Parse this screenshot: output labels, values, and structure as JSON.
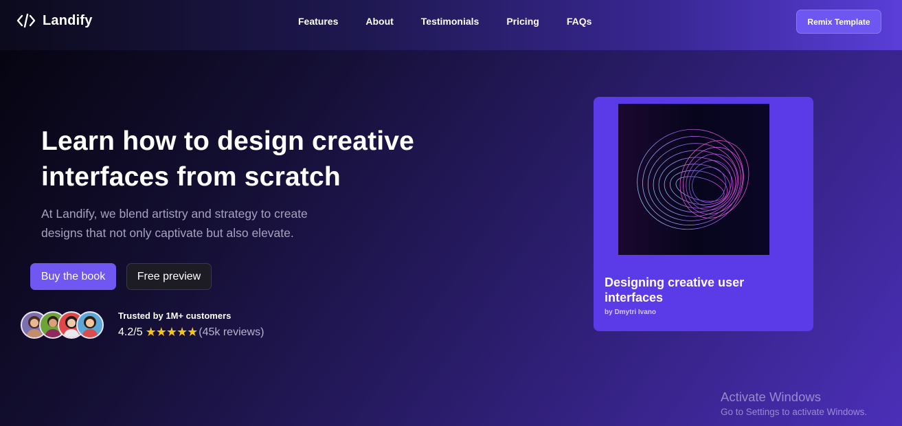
{
  "brand": {
    "name": "Landify",
    "icon": "code-brackets-icon"
  },
  "nav": {
    "links": [
      "Features",
      "About",
      "Testimonials",
      "Pricing",
      "FAQs"
    ],
    "cta_label": "Remix Template"
  },
  "hero": {
    "title_line1": "Learn how to design creative",
    "title_line2": "interfaces from scratch",
    "subtitle_line1": "At Landify, we blend artistry and strategy to create",
    "subtitle_line2": "designs that not only captivate but also elevate.",
    "buy_label": "Buy the book",
    "preview_label": "Free preview"
  },
  "trust": {
    "title": "Trusted by 1M+ customers",
    "rating": "4.2/5",
    "stars": "★★★★★",
    "reviews": "(45k reviews)",
    "avatars": [
      "avatar-woman-icon",
      "avatar-man-icon",
      "avatar-woman-icon",
      "avatar-woman-icon"
    ]
  },
  "book": {
    "title": "Designing creative user interfaces",
    "author": "by Dmytri Ivano",
    "cover_icon": "abstract-ribbon-icon"
  },
  "watermark": {
    "title": "Activate Windows",
    "subtitle": "Go to Settings to activate Windows."
  },
  "colors": {
    "accent": "#7057f2",
    "card": "#5b3ae8",
    "star": "#f5c518",
    "background_dark": "#05030d"
  }
}
